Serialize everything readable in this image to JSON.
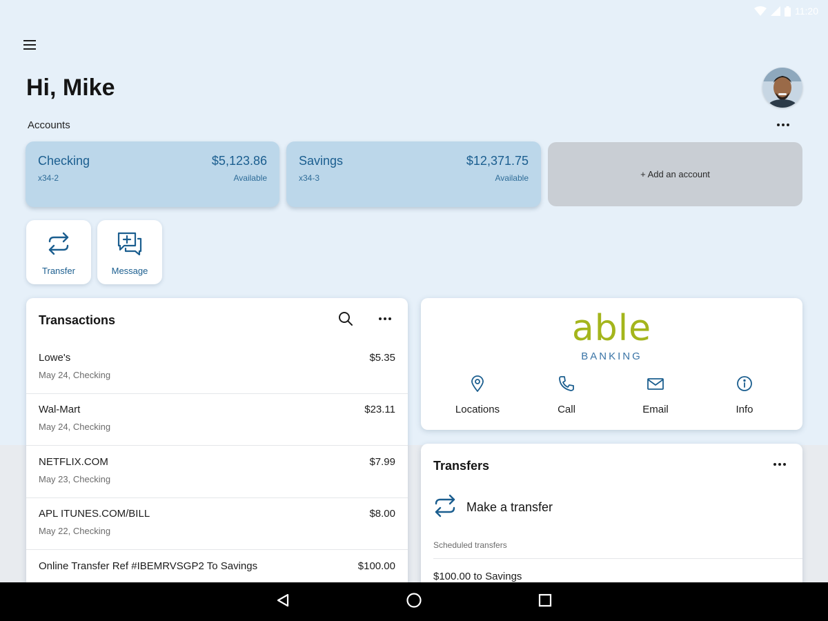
{
  "status_bar": {
    "time": "11:20"
  },
  "greeting": "Hi, Mike",
  "accounts": {
    "label": "Accounts",
    "items": [
      {
        "name": "Checking",
        "number": "x34-2",
        "amount": "$5,123.86",
        "amount_label": "Available"
      },
      {
        "name": "Savings",
        "number": "x34-3",
        "amount": "$12,371.75",
        "amount_label": "Available"
      }
    ],
    "add_label": "+ Add an account"
  },
  "actions": {
    "transfer": "Transfer",
    "message": "Message"
  },
  "transactions": {
    "title": "Transactions",
    "rows": [
      {
        "merchant": "Lowe's",
        "meta": "May 24, Checking",
        "amount": "$5.35"
      },
      {
        "merchant": "Wal-Mart",
        "meta": "May 24, Checking",
        "amount": "$23.11"
      },
      {
        "merchant": "NETFLIX.COM",
        "meta": "May 23, Checking",
        "amount": "$7.99"
      },
      {
        "merchant": "APL ITUNES.COM/BILL",
        "meta": "May 22, Checking",
        "amount": "$8.00"
      },
      {
        "merchant": "Online Transfer Ref #IBEMRVSGP2 To Savings",
        "meta": "",
        "amount": "$100.00"
      }
    ]
  },
  "bank": {
    "brand": "able",
    "sub": "BANKING",
    "contacts": {
      "locations": "Locations",
      "call": "Call",
      "email": "Email",
      "info": "Info"
    }
  },
  "transfers": {
    "title": "Transfers",
    "make_transfer": "Make a transfer",
    "scheduled_label": "Scheduled transfers",
    "scheduled_items": [
      "$100.00 to Savings"
    ]
  },
  "colors": {
    "accent": "#1b5e8f",
    "account_card": "#bcd7ea",
    "brand_green": "#a4b51c",
    "background": "#e6f0f9"
  }
}
